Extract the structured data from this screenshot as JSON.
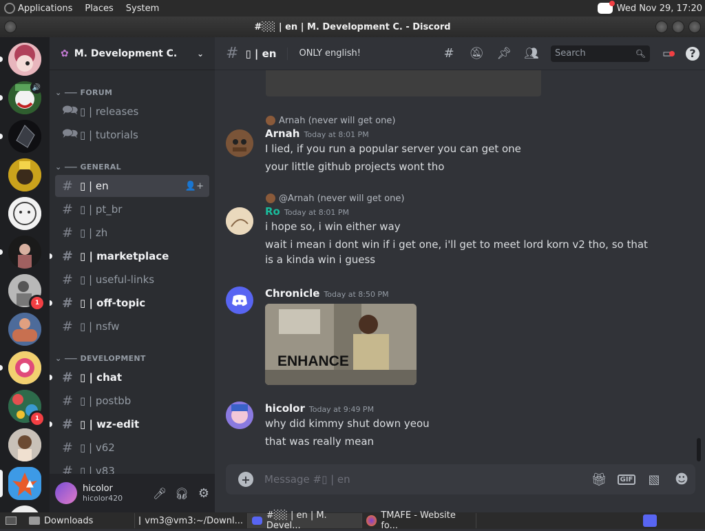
{
  "system": {
    "menus": [
      "Applications",
      "Places",
      "System"
    ],
    "datetime": "Wed Nov 29, 17:20"
  },
  "window": {
    "title": "#░░ | en | M. Development C. - Discord"
  },
  "server": {
    "name": "M. Development C."
  },
  "servers": [
    {
      "badge": ""
    },
    {
      "badge": ""
    },
    {
      "badge": ""
    },
    {
      "badge": ""
    },
    {
      "badge": ""
    },
    {
      "badge": ""
    },
    {
      "badge": "1"
    },
    {
      "badge": ""
    },
    {
      "badge": ""
    },
    {
      "badge": "1"
    },
    {
      "badge": ""
    },
    {
      "badge": ""
    }
  ],
  "categories": {
    "forum": "FORUM",
    "general": "GENERAL",
    "development": "DEVELOPMENT"
  },
  "channels": [
    {
      "name": "▯ | releases"
    },
    {
      "name": "▯ | tutorials"
    },
    {
      "name": "▯ | en"
    },
    {
      "name": "▯ | pt_br"
    },
    {
      "name": "▯ | zh"
    },
    {
      "name": "▯ | marketplace"
    },
    {
      "name": "▯ | useful-links"
    },
    {
      "name": "▯ | off-topic"
    },
    {
      "name": "▯ | nsfw"
    },
    {
      "name": "▯ | chat"
    },
    {
      "name": "▯ | postbb"
    },
    {
      "name": "▯ | wz-edit"
    },
    {
      "name": "▯ | v62"
    },
    {
      "name": "▯ | v83"
    }
  ],
  "channel_header": {
    "name": "▯ | en",
    "topic": "ONLY english!",
    "search_placeholder": "Search"
  },
  "messages": {
    "m1": {
      "reply_to": "Arnah (never will get one)",
      "author": "Arnah",
      "time": "Today at 8:01 PM",
      "lines": [
        "I lied, if you run a popular server you can get one",
        "your little github projects wont tho"
      ]
    },
    "m2": {
      "reply_to": "@Arnah (never will get one)",
      "author": "Ro",
      "time": "Today at 8:01 PM",
      "lines": [
        "i hope so, i win either way",
        "wait i mean i dont win if i get one, i'll get to meet lord korn v2 tho, so that is a kinda win i guess"
      ]
    },
    "m3": {
      "author": "Chronicle",
      "time": "Today at 8:50 PM",
      "image_caption": "ENHANCE"
    },
    "m4": {
      "author": "hicolor",
      "time": "Today at 9:49 PM",
      "lines": [
        "why did kimmy shut down yeou",
        "that was really mean"
      ]
    }
  },
  "composer": {
    "placeholder": "Message #▯ | en",
    "gif": "GIF"
  },
  "user": {
    "display": "hicolor",
    "tag": "hicolor420"
  },
  "taskbar": [
    {
      "label": "Downloads"
    },
    {
      "label": "vm3@vm3:~/Downl..."
    },
    {
      "label": "#░░ | en | M. Devel..."
    },
    {
      "label": "TMAFE - Website fo..."
    }
  ],
  "colors": {
    "accent": "#5865f2",
    "ro_name": "#1abc9c",
    "badge": "#f23f43"
  }
}
